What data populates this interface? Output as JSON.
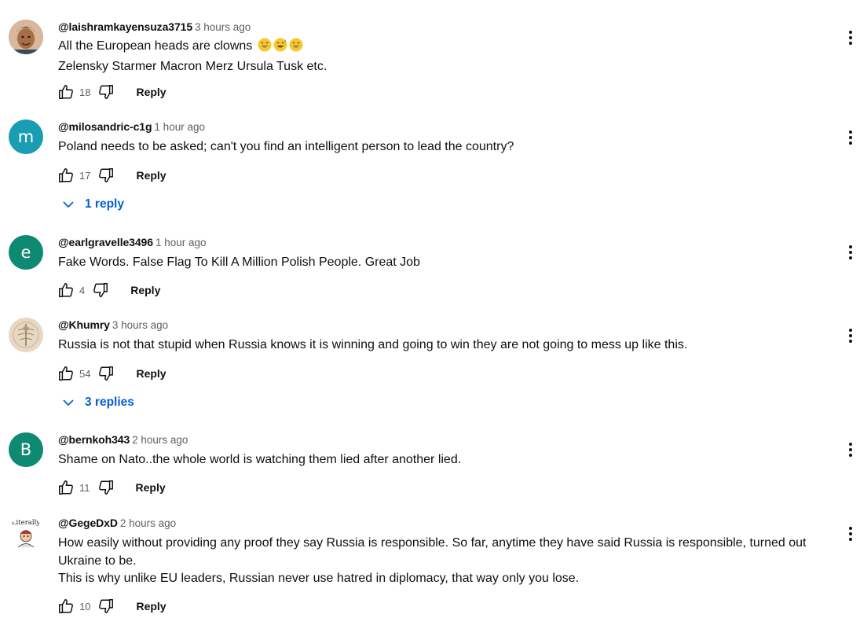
{
  "comments": [
    {
      "author": "@laishramkayensuza3715",
      "time": "3 hours ago",
      "lines": [
        "All the European heads are clowns",
        "Zelensky Starmer Macron Merz Ursula Tusk etc."
      ],
      "emojis": [
        "grinning-face",
        "grinning-sweat-face",
        "grinning-face"
      ],
      "likes": "18",
      "reply_label": "Reply",
      "avatar": {
        "type": "photo",
        "bg": "#b98a6a"
      }
    },
    {
      "author": "@milosandric-c1g",
      "time": "1 hour ago",
      "lines": [
        "Poland needs to be asked; can't you find an intelligent person to lead the country?"
      ],
      "likes": "17",
      "reply_label": "Reply",
      "replies_label": "1 reply",
      "avatar": {
        "type": "letter",
        "letter": "m",
        "bg": "#1a9cb3"
      }
    },
    {
      "author": "@earlgravelle3496",
      "time": "1 hour ago",
      "lines": [
        "Fake Words. False Flag To Kill A Million Polish People. Great Job"
      ],
      "likes": "4",
      "reply_label": "Reply",
      "avatar": {
        "type": "letter",
        "letter": "e",
        "bg": "#0f8a72"
      }
    },
    {
      "author": "@Khumry",
      "time": "3 hours ago",
      "lines": [
        "Russia is not that stupid when Russia knows it is winning and going to win they are not going to mess up like this."
      ],
      "likes": "54",
      "reply_label": "Reply",
      "replies_label": "3 replies",
      "avatar": {
        "type": "image",
        "bg": "#e8dcc8"
      }
    },
    {
      "author": "@bernkoh343",
      "time": "2 hours ago",
      "lines": [
        "Shame on Nato..the whole world is watching them lied after another lied."
      ],
      "likes": "11",
      "reply_label": "Reply",
      "avatar": {
        "type": "letter",
        "letter": "B",
        "bg": "#0f8a72"
      }
    },
    {
      "author": "@GegeDxD",
      "time": "2 hours ago",
      "lines": [
        "How easily without providing any proof they say Russia is responsible. So far, anytime they have said Russia is responsible, turned out Ukraine to be.",
        "This is why unlike EU leaders, Russian never use hatred in diplomacy, that way only you lose."
      ],
      "likes": "10",
      "reply_label": "Reply",
      "avatar": {
        "type": "image",
        "bg": "#ffffff",
        "text": "Literally"
      }
    }
  ],
  "colors": {
    "link_blue": "#065fd4",
    "secondary_text": "#606060",
    "primary_text": "#0f0f0f"
  }
}
